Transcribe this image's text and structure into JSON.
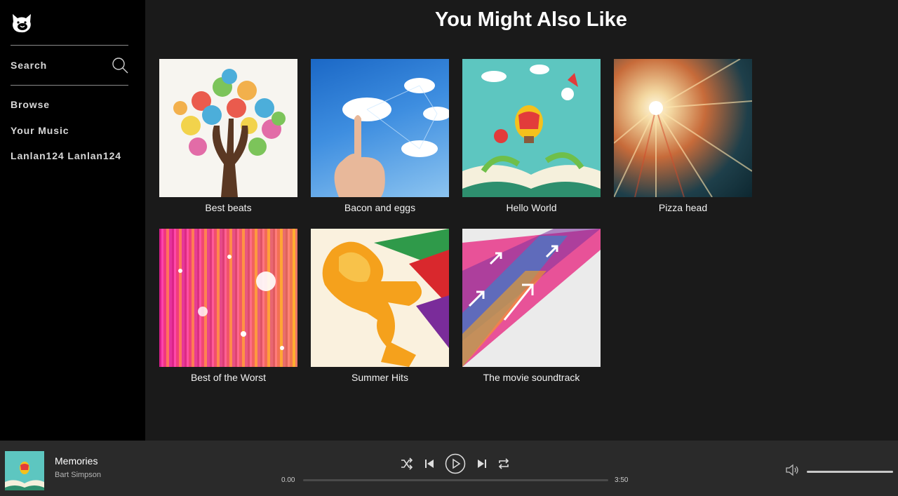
{
  "sidebar": {
    "search_label": "Search",
    "nav": [
      {
        "label": "Browse"
      },
      {
        "label": "Your Music"
      },
      {
        "label": "Lanlan124 Lanlan124"
      }
    ]
  },
  "main": {
    "title": "You Might Also Like",
    "playlists": [
      {
        "title": "Best beats"
      },
      {
        "title": "Bacon and eggs"
      },
      {
        "title": "Hello World"
      },
      {
        "title": "Pizza head"
      },
      {
        "title": "Best of the Worst"
      },
      {
        "title": "Summer Hits"
      },
      {
        "title": "The movie soundtrack"
      }
    ]
  },
  "player": {
    "track_title": "Memories",
    "artist": "Bart Simpson",
    "elapsed": "0.00",
    "duration": "3:50",
    "progress": 0,
    "volume": 1.0
  },
  "colors": {
    "sidebar_bg": "#000000",
    "main_bg": "#1a1a1a",
    "player_bg": "#2a2a2a"
  }
}
